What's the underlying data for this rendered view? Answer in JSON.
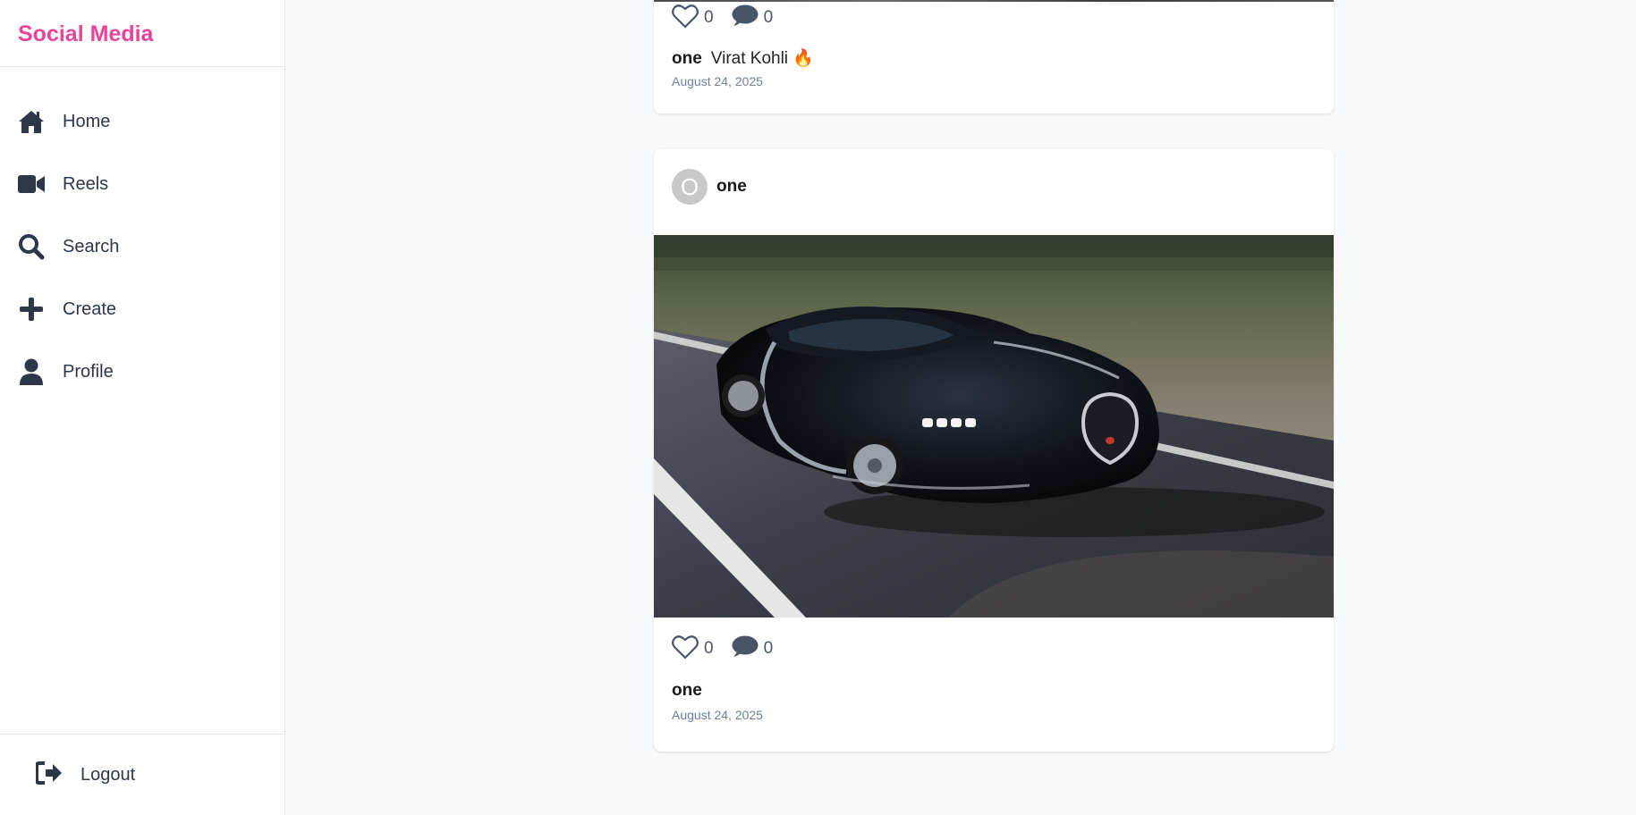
{
  "brand": {
    "title": "Social Media",
    "color": "#e8459a"
  },
  "nav": {
    "items": [
      {
        "label": "Home",
        "icon": "home-icon"
      },
      {
        "label": "Reels",
        "icon": "video-camera-icon"
      },
      {
        "label": "Search",
        "icon": "search-icon"
      },
      {
        "label": "Create",
        "icon": "plus-icon"
      },
      {
        "label": "Profile",
        "icon": "user-icon"
      }
    ],
    "logout_label": "Logout",
    "logout_icon": "logout-icon"
  },
  "feed": {
    "posts": [
      {
        "username": "one",
        "caption": "Virat Kohli 🔥",
        "likes": "0",
        "comments": "0",
        "date": "August 24, 2025"
      },
      {
        "username": "one",
        "avatar_initial": "O",
        "caption": "",
        "likes": "0",
        "comments": "0",
        "date": "August 24, 2025",
        "image": "car-photo"
      }
    ]
  }
}
